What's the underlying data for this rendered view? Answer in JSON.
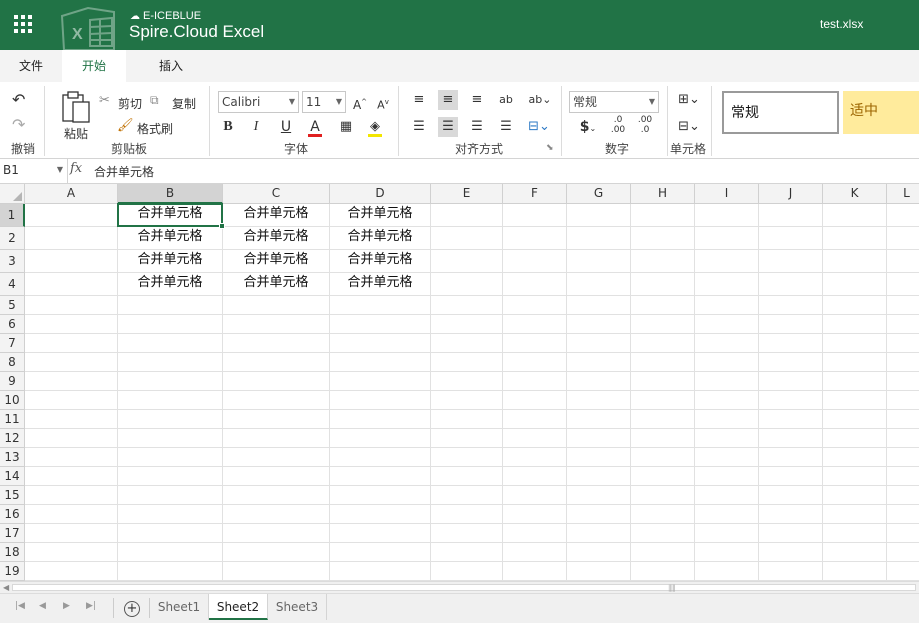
{
  "app": {
    "brand_top": "E-ICEBLUE",
    "brand_main": "Spire.Cloud Excel",
    "filename": "test.xlsx"
  },
  "ribbon_tabs": [
    {
      "label": "文件",
      "active": false
    },
    {
      "label": "开始",
      "active": true
    },
    {
      "label": "插入",
      "active": false
    }
  ],
  "ribbon": {
    "undo_label": "撤销",
    "paste_label": "粘贴",
    "cut_label": "剪切",
    "copy_label": "复制",
    "format_painter_label": "格式刷",
    "clipboard_group": "剪贴板",
    "font_name": "Calibri",
    "font_size": "11",
    "font_group": "字体",
    "align_group": "对齐方式",
    "number_format": "常规",
    "number_group": "数字",
    "cells_group": "单元格",
    "style_normal": "常规",
    "style_neutral": "适中",
    "font_color": "#e02020",
    "fill_color": "#f3e600"
  },
  "formula_bar": {
    "name_box": "B1",
    "fx": "fx",
    "value": "合并单元格"
  },
  "grid": {
    "columns": [
      "A",
      "B",
      "C",
      "D",
      "E",
      "F",
      "G",
      "H",
      "I",
      "J",
      "K",
      "L"
    ],
    "selected_column": "B",
    "rows": [
      "1",
      "2",
      "3",
      "4",
      "5",
      "6",
      "7",
      "8",
      "9",
      "10",
      "11",
      "12",
      "13",
      "14",
      "15",
      "16",
      "17",
      "18",
      "19"
    ],
    "selected_row": "1",
    "cells": [
      [
        "",
        "合并单元格",
        "合并单元格",
        "合并单元格"
      ],
      [
        "",
        "合并单元格",
        "合并单元格",
        "合并单元格"
      ],
      [
        "",
        "合并单元格",
        "合并单元格",
        "合并单元格"
      ],
      [
        "",
        "合并单元格",
        "合并单元格",
        "合并单元格"
      ]
    ]
  },
  "sheets": [
    {
      "label": "Sheet1",
      "active": false
    },
    {
      "label": "Sheet2",
      "active": true
    },
    {
      "label": "Sheet3",
      "active": false
    }
  ],
  "colors": {
    "brand": "#217346"
  }
}
